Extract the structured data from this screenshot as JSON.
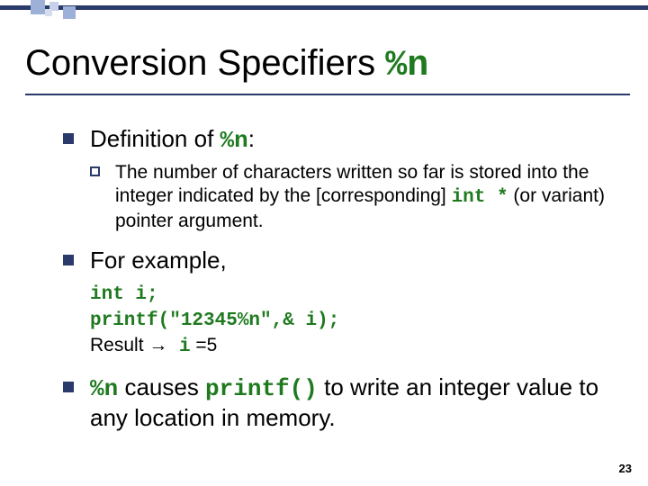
{
  "title": {
    "prefix": "Conversion Specifiers ",
    "code": "%n"
  },
  "bullets": {
    "b1": {
      "prefix": "Definition of ",
      "code": "%n",
      "suffix": ":"
    },
    "b1sub": {
      "prefix": "The number of characters written so far is stored into the integer indicated by the [corresponding] ",
      "code": "int *",
      "suffix": " (or variant) pointer argument."
    },
    "b2": "For example,",
    "b2code": {
      "line1": "int i;",
      "line2": "printf(\"12345%n\",& i);",
      "line3_prefix": "Result ",
      "line3_arrow": "→",
      "line3_code": " i",
      "line3_suffix": " =5"
    },
    "b3": {
      "code1": "%n",
      "mid1": " causes ",
      "code2": "printf()",
      "suffix": " to write an integer value to any location in memory."
    }
  },
  "page_number": "23"
}
